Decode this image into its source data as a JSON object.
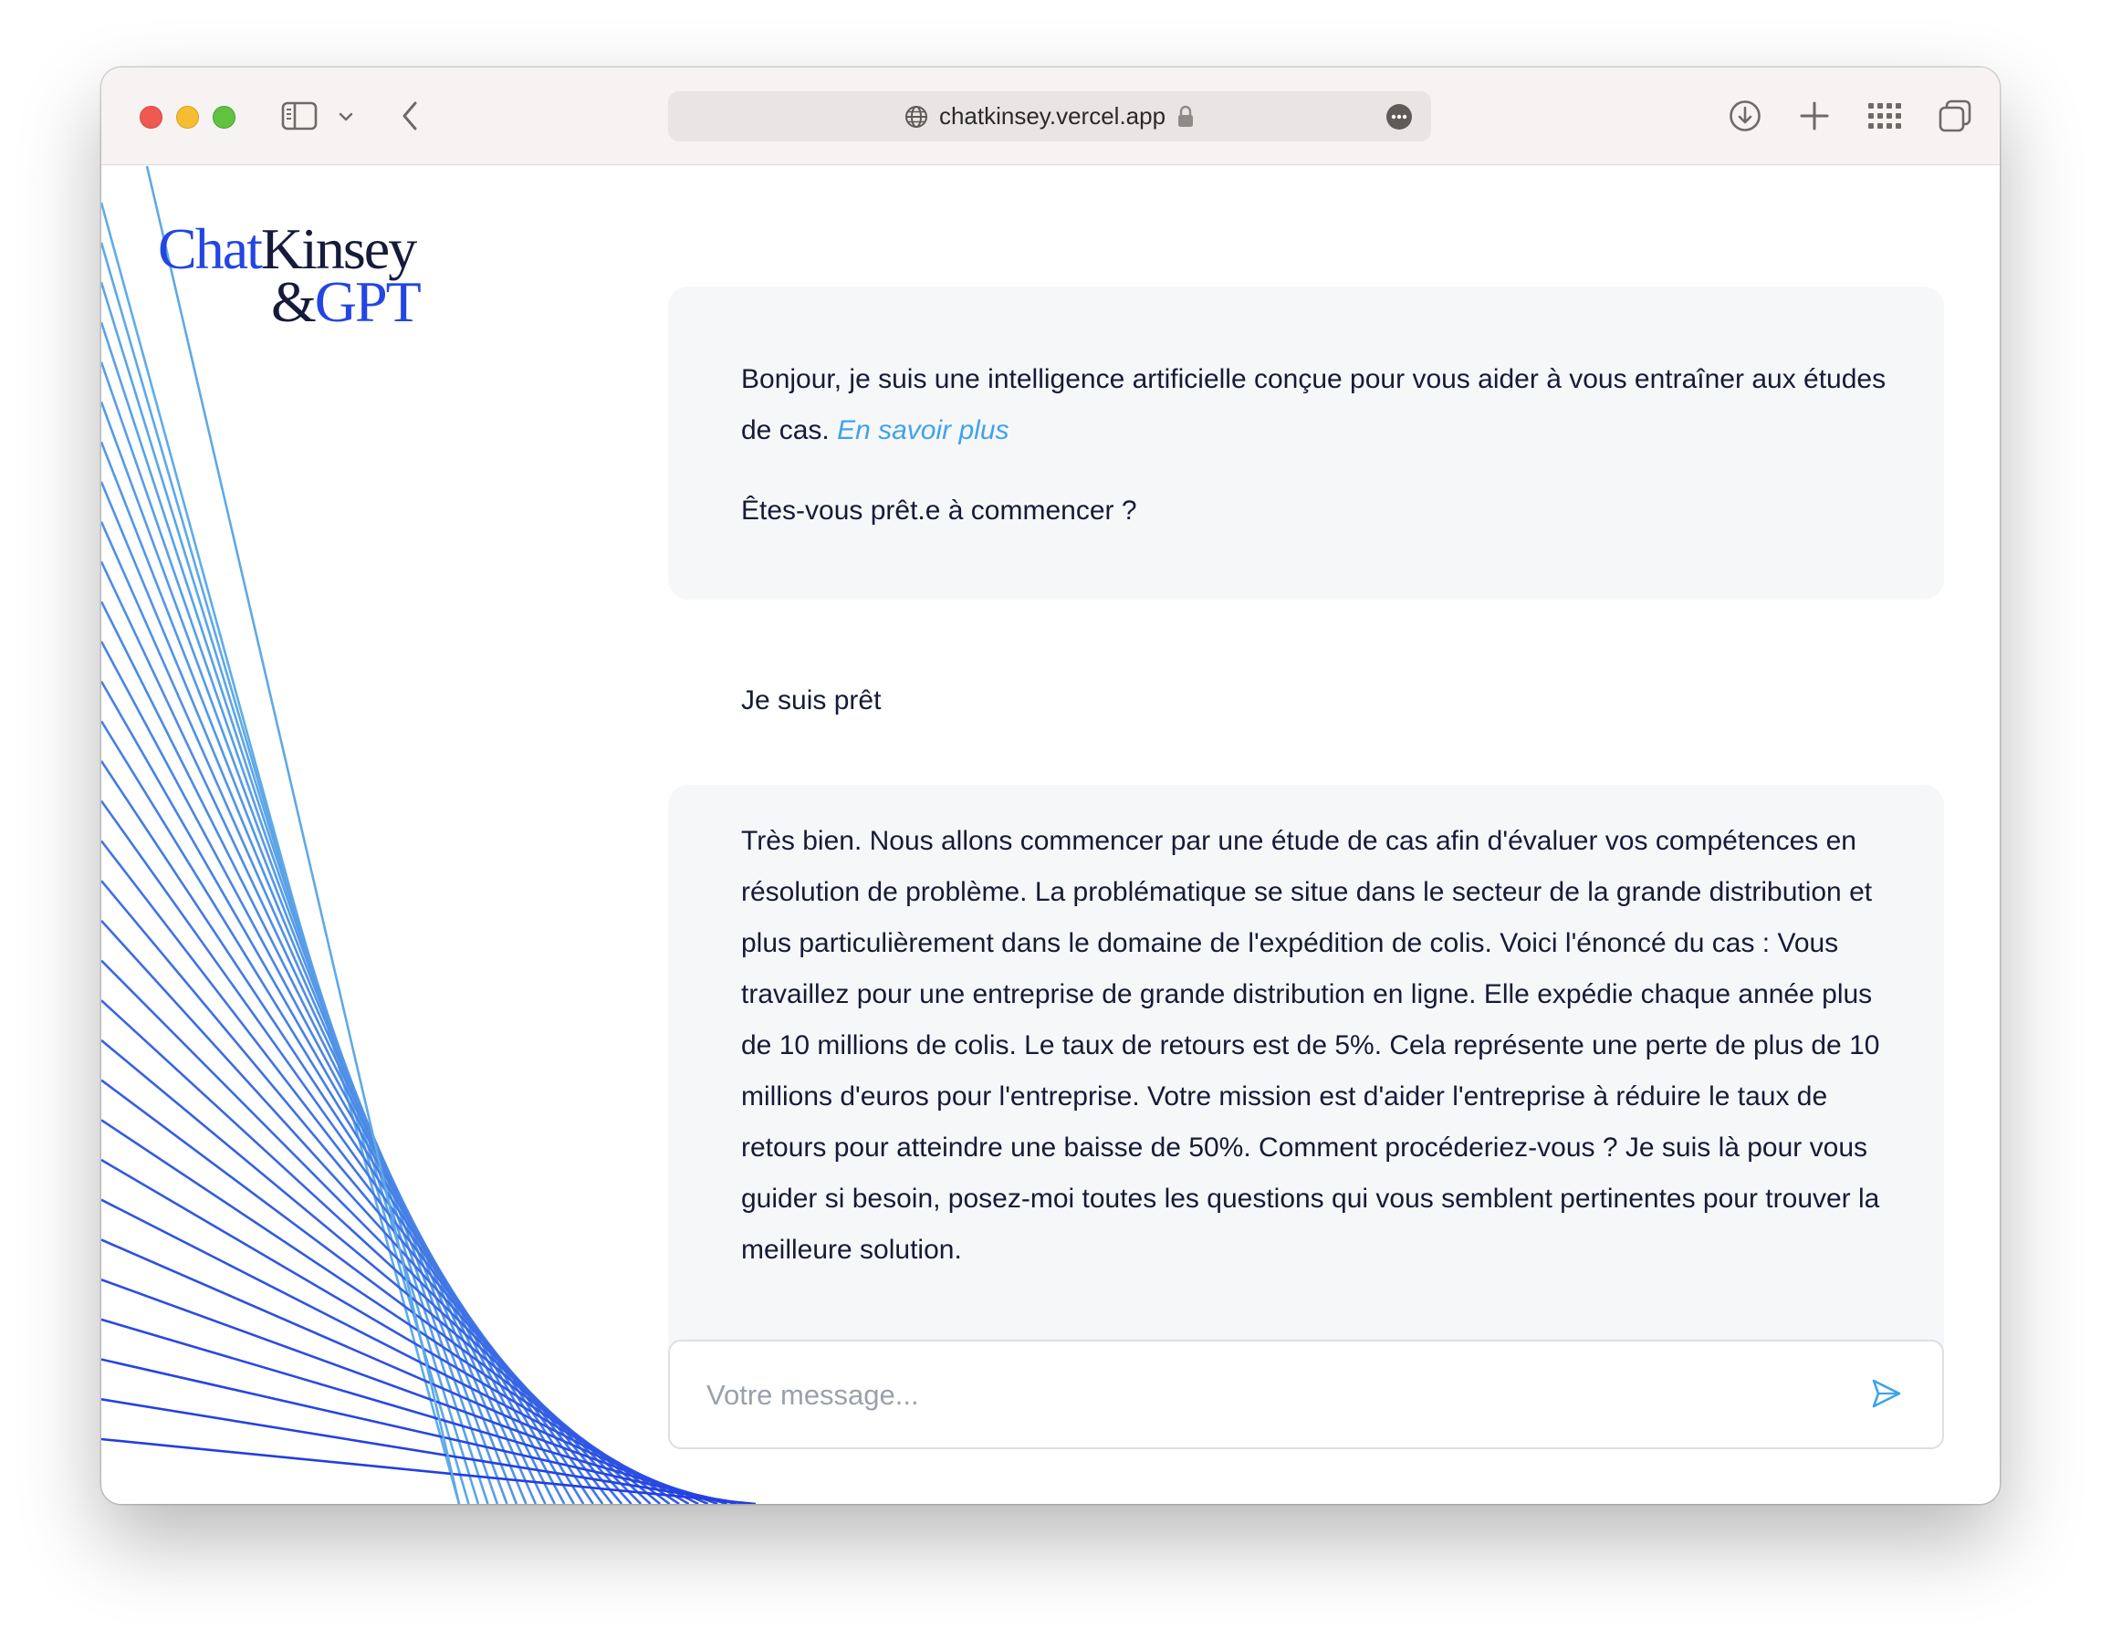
{
  "browser": {
    "url": "chatkinsey.vercel.app",
    "icons": {
      "sidebar": "sidebar-icon",
      "chevron": "chevron-down-icon",
      "back": "back-arrow-icon",
      "globe": "globe-icon",
      "lock": "lock-icon",
      "more": "more-icon",
      "download": "download-icon",
      "new_tab": "plus-icon",
      "grid": "grid-icon",
      "tabs": "tabs-overview-icon"
    }
  },
  "logo": {
    "word1": "Chat",
    "word2": "Kinsey",
    "word3": "&",
    "word4": "GPT",
    "colors": {
      "blue": "#2346e2",
      "dark": "#161b3b"
    }
  },
  "chat": {
    "messages": [
      {
        "role": "assistant",
        "text_before_link": "Bonjour, je suis une intelligence artificielle conçue pour vous aider à vous entraîner aux études de cas.",
        "link_text": "En savoir plus",
        "question": "Êtes-vous prêt.e à commencer ?"
      },
      {
        "role": "user",
        "text": "Je suis prêt"
      },
      {
        "role": "assistant",
        "text": "Très bien. Nous allons commencer par une étude de cas afin d'évaluer vos compétences en résolution de problème. La problématique se situe dans le secteur de la grande distribution et plus particulièrement dans le domaine de l'expédition de colis. Voici l'énoncé du cas : Vous travaillez pour une entreprise de grande distribution en ligne. Elle expédie chaque année plus de 10 millions de colis. Le taux de retours est de 5%. Cela représente une perte de plus de 10 millions d'euros pour l'entreprise. Votre mission est d'aider l'entreprise à réduire le taux de retours pour atteindre une baisse de 50%. Comment procéderiez-vous ? Je suis là pour vous guider si besoin, posez-moi toutes les questions qui vous semblent pertinentes pour trouver la meilleure solution."
      }
    ]
  },
  "composer": {
    "placeholder": "Votre message...",
    "value": "",
    "send_icon": "send-icon",
    "accent_color": "#3ea3ec"
  }
}
